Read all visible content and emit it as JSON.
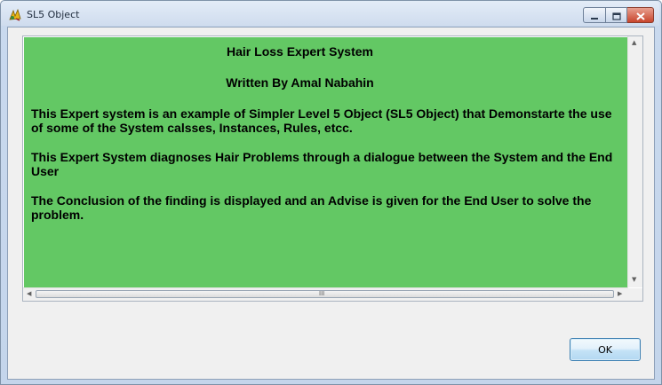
{
  "window": {
    "title": "SL5 Object",
    "icon": "sl5-app-icon"
  },
  "caption_buttons": {
    "minimize_icon": "minimize-icon",
    "maximize_icon": "maximize-icon",
    "close_icon": "close-icon"
  },
  "content": {
    "background_color": "#63c864",
    "title": "Hair Loss Expert System",
    "author": "Written By Amal Nabahin",
    "paragraphs": [
      "This Expert system is an example of Simpler Level 5 Object (SL5 Object) that Demonstarte the use of some of the System calsses, Instances, Rules, etcc.",
      "This Expert System diagnoses Hair Problems through a dialogue between the System and the End User",
      "The Conclusion of the finding is displayed and an Advise is given for the End User to solve the problem."
    ]
  },
  "scrollbars": {
    "grip_glyph": "III"
  },
  "buttons": {
    "ok_label": "OK"
  }
}
